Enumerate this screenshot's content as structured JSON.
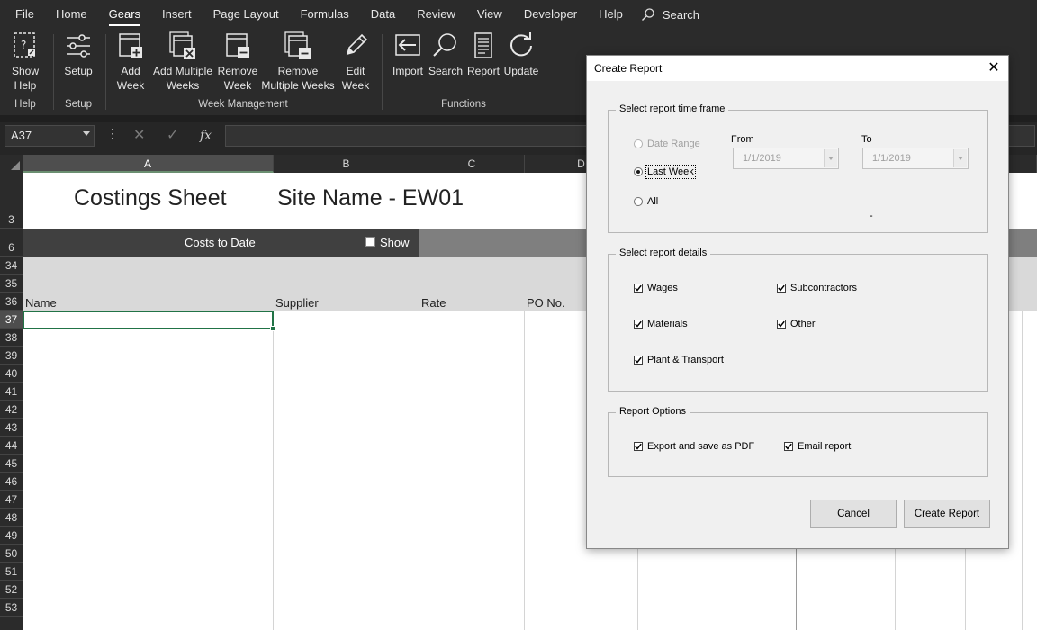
{
  "menu": {
    "items": [
      "File",
      "Home",
      "Gears",
      "Insert",
      "Page Layout",
      "Formulas",
      "Data",
      "Review",
      "View",
      "Developer",
      "Help"
    ],
    "active": "Gears",
    "search_label": "Search"
  },
  "ribbon": {
    "buttons": {
      "show_help": "Show\nHelp",
      "setup": "Setup",
      "add_week": "Add\nWeek",
      "add_multiple_weeks": "Add Multiple\nWeeks",
      "remove_week": "Remove\nWeek",
      "remove_multiple_weeks": "Remove\nMultiple Weeks",
      "edit_week": "Edit\nWeek",
      "import": "Import",
      "search": "Search",
      "report": "Report",
      "update": "Update"
    },
    "groups": {
      "help": "Help",
      "setup": "Setup",
      "week_management": "Week Management",
      "functions": "Functions"
    }
  },
  "formula_bar": {
    "name_box": "A37",
    "fx": "fx",
    "value": ""
  },
  "grid": {
    "columns": [
      "A",
      "B",
      "C",
      "D"
    ],
    "selected_column": "A",
    "rows": [
      "3",
      "6",
      "34",
      "35",
      "36",
      "37",
      "38",
      "39",
      "40",
      "41",
      "42",
      "43",
      "44",
      "45",
      "46",
      "47",
      "48",
      "49",
      "50",
      "51",
      "52",
      "53"
    ],
    "selected_row": "37",
    "sheet_title": "Costings Sheet",
    "site_name": "Site Name - EW01",
    "costs_to_date": "Costs to Date",
    "show_label": "Show",
    "headers": [
      "Name",
      "Supplier",
      "Rate",
      "PO No."
    ]
  },
  "dialog": {
    "title": "Create Report",
    "time_frame": {
      "label": "Select report time frame",
      "options": [
        "Date Range",
        "Last Week",
        "All"
      ],
      "selected": "Last Week",
      "from_label": "From",
      "to_label": "To",
      "from_value": "1/1/2019",
      "to_value": "1/1/2019",
      "separator": "-"
    },
    "details": {
      "label": "Select report details",
      "wages": "Wages",
      "subcontractors": "Subcontractors",
      "materials": "Materials",
      "other": "Other",
      "plant_transport": "Plant & Transport"
    },
    "options": {
      "label": "Report Options",
      "export_pdf": "Export and save as PDF",
      "email": "Email report"
    },
    "buttons": {
      "cancel": "Cancel",
      "create": "Create Report"
    }
  }
}
